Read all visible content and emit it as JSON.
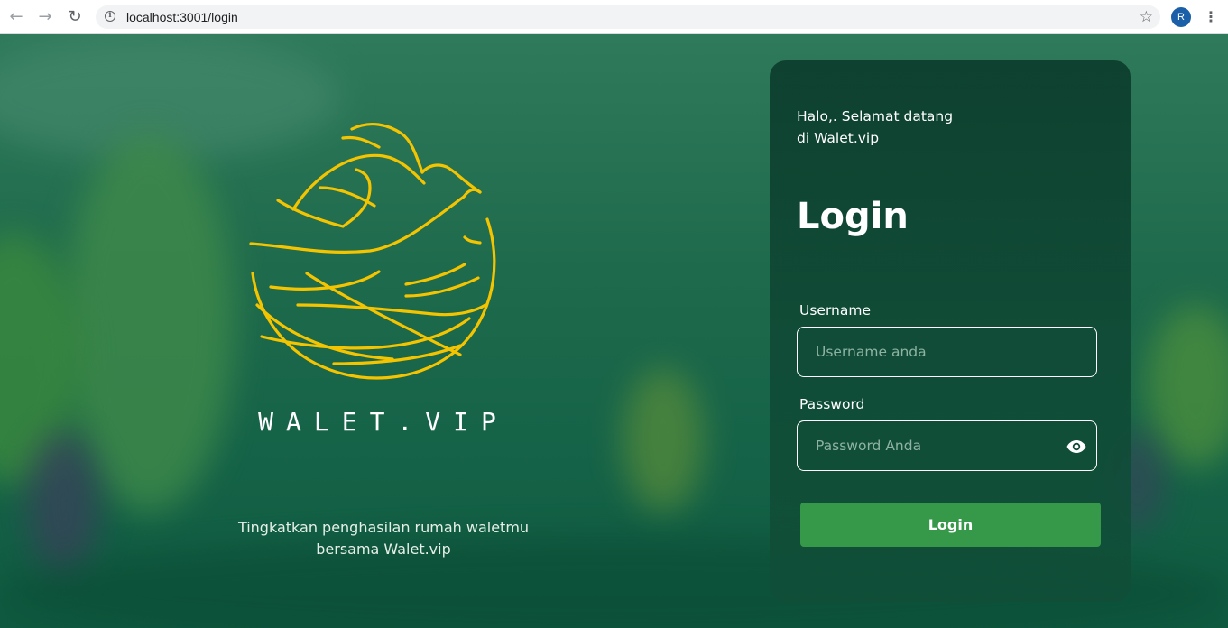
{
  "browser": {
    "url": "localhost:3001/login",
    "profile_initial": "R",
    "back_icon": "arrow-left-icon",
    "forward_icon": "arrow-right-icon",
    "reload_icon": "reload-icon",
    "bookmark_icon": "star-icon",
    "menu_icon": "more-vert-icon"
  },
  "hero": {
    "brand": "WALET.VIP",
    "tagline_line1": "Tingkatkan penghasilan rumah waletmu",
    "tagline_line2": "bersama Walet.vip",
    "logo_icon": "swiftlet-nest-logo-icon",
    "logo_color": "#f5c400"
  },
  "card": {
    "welcome_line1": "Halo,. Selamat datang",
    "welcome_line2": "di Walet.vip",
    "title": "Login",
    "username_label": "Username",
    "username_placeholder": "Username anda",
    "password_label": "Password",
    "password_placeholder": "Password Anda",
    "show_password_icon": "eye-icon",
    "submit_label": "Login"
  },
  "colors": {
    "background": "#1e6a4c",
    "card": "#0f4a36",
    "button": "#36994a",
    "accent": "#f5c400"
  }
}
